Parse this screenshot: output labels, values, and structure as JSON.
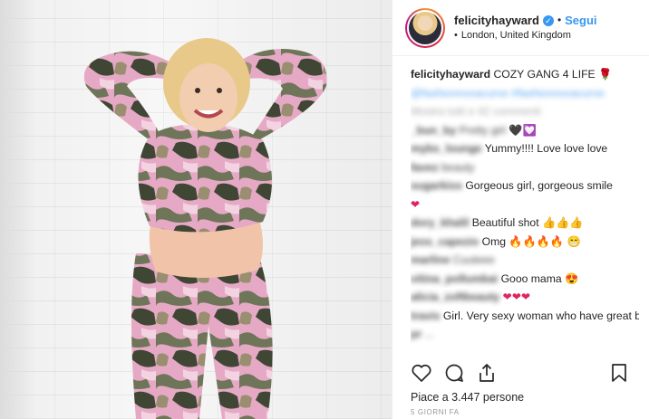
{
  "post": {
    "username": "felicityhayward",
    "follow_label": "Segui",
    "location": "London, United Kingdom",
    "caption_user": "felicityhayward",
    "caption_text": "COZY GANG 4 LIFE",
    "caption_tags": "@fashionnovacurve #fashionnovacurve",
    "show_all_label": "Mostra tutti e 42 commenti",
    "likes_text": "Piace a 3.447 persone",
    "time_text": "5 GIORNI FA"
  },
  "comments": [
    {
      "user": "_bun_by",
      "text": "Pretty girl"
    },
    {
      "user": "mybs_lounge",
      "text": "Yummy!!!! Love love love"
    },
    {
      "user": "favez",
      "text": "beauty"
    },
    {
      "user": "sugarkiss",
      "text": "Gorgeous girl, gorgeous smile"
    },
    {
      "user": "",
      "text": "❤"
    },
    {
      "user": "dory_khalil",
      "text": "Beautiful shot 👍👍👍"
    },
    {
      "user": "jess_capezio",
      "text": "Omg 🔥🔥🔥🔥 😁"
    },
    {
      "user": "marline",
      "text": "Cuuteee"
    },
    {
      "user": "vitina_pollumbai",
      "text": "Gooo mama 😍"
    },
    {
      "user": "alicia_zoftbeauty",
      "text": "❤❤❤"
    },
    {
      "user": "travis",
      "text": "Girl. Very sexy woman who have great body on you beautiful"
    },
    {
      "user": "pr",
      "text": "..."
    }
  ],
  "icons": {
    "like": "heart-outline-icon",
    "comment": "comment-bubble-icon",
    "share": "share-icon",
    "save": "bookmark-icon"
  },
  "colors": {
    "accent": "#3897f0",
    "text": "#262626",
    "muted": "#999999",
    "heart": "#e0245e"
  }
}
